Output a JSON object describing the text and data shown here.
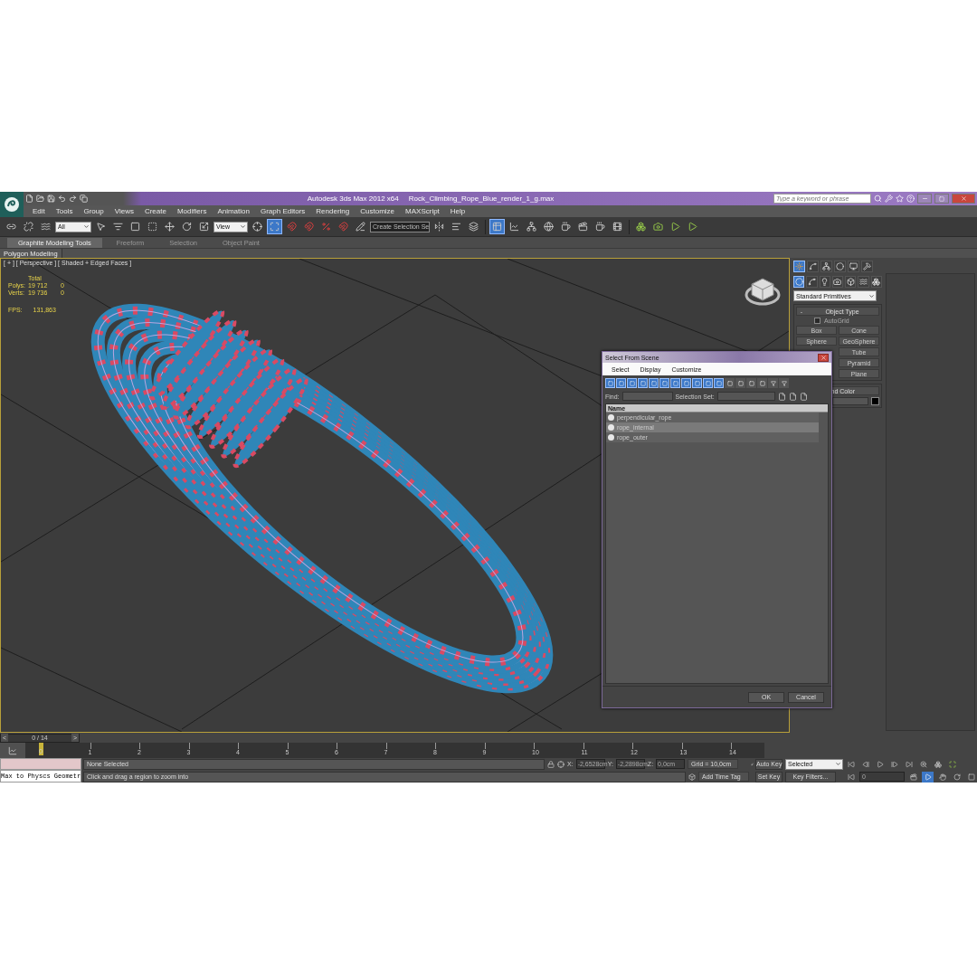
{
  "title_bar": {
    "app_title": "Autodesk 3ds Max  2012 x64",
    "file_name": "Rock_Climbing_Rope_Blue_render_1_g.max",
    "search": {
      "placeholder": "Type a keyword or phrase"
    }
  },
  "menu": [
    "Edit",
    "Tools",
    "Group",
    "Views",
    "Create",
    "Modifiers",
    "Animation",
    "Graph Editors",
    "Rendering",
    "Customize",
    "MAXScript",
    "Help"
  ],
  "main_toolbar": {
    "selection_filter": "All",
    "reference_coordinate": "View",
    "named_selection": "Create Selection Se"
  },
  "ribbon": {
    "tabs": [
      {
        "label": "Graphite Modeling Tools",
        "selected": true
      },
      {
        "label": "Freeform",
        "selected": false
      },
      {
        "label": "Selection",
        "selected": false
      },
      {
        "label": "Object Paint",
        "selected": false
      }
    ],
    "panel": "Polygon Modeling"
  },
  "viewport": {
    "label": "[ + ] [ Perspective ] [ Shaded + Edged Faces ]",
    "stats": {
      "total": "Total",
      "rows": [
        {
          "label": "Polys:",
          "total": "19 712",
          "selected": "0"
        },
        {
          "label": "Verts:",
          "total": "19 736",
          "selected": "0"
        }
      ],
      "fps_label": "FPS:",
      "fps": "131,863"
    }
  },
  "select_dialog": {
    "title": "Select From Scene",
    "menu": [
      "Select",
      "Display",
      "Customize"
    ],
    "display_filters": [
      {
        "on": true
      },
      {
        "on": true
      },
      {
        "on": true
      },
      {
        "on": true
      },
      {
        "on": true
      },
      {
        "on": true
      },
      {
        "on": true
      },
      {
        "on": true
      },
      {
        "on": true
      },
      {
        "on": true
      },
      {
        "on": true
      },
      {
        "on": false
      },
      {
        "on": false
      },
      {
        "on": false
      },
      {
        "on": false
      },
      {
        "on": false
      },
      {
        "on": false
      }
    ],
    "find_label": "Find:",
    "selection_set_label": "Selection Set:",
    "column": "Name",
    "rows": [
      {
        "name": "perpendicular_rope",
        "selected": false
      },
      {
        "name": "rope_internal",
        "selected": true
      },
      {
        "name": "rope_outer",
        "selected": false
      }
    ],
    "ok": "OK",
    "cancel": "Cancel"
  },
  "command_panel": {
    "tabs": [
      {
        "selected": true
      },
      {
        "selected": false
      },
      {
        "selected": false
      },
      {
        "selected": false
      },
      {
        "selected": false
      },
      {
        "selected": false
      }
    ],
    "categories": [
      {
        "selected": true
      },
      {
        "selected": false
      },
      {
        "selected": false
      },
      {
        "selected": false
      },
      {
        "selected": false
      },
      {
        "selected": false
      },
      {
        "selected": false
      }
    ],
    "primitive_type": "Standard Primitives",
    "object_type": {
      "title": "Object Type",
      "collapse": "-",
      "autogrid": {
        "label": "AutoGrid",
        "checked": false
      },
      "left_column": [
        "Box",
        "Sphere"
      ],
      "right_column": [
        "Cone",
        "GeoSphere",
        "Tube",
        "Pyramid",
        "Plane"
      ]
    },
    "name_color": {
      "title": "nd Color"
    }
  },
  "time_slider": {
    "level": 0,
    "frame": "0 / 14",
    "prev": "<",
    "next": ">"
  },
  "track_bar": {
    "ticks": [
      {
        "label": "0",
        "current": true
      },
      {
        "label": "1",
        "current": false
      },
      {
        "label": "2",
        "current": false
      },
      {
        "label": "3",
        "current": false
      },
      {
        "label": "4",
        "current": false
      },
      {
        "label": "5",
        "current": false
      },
      {
        "label": "6",
        "current": false
      },
      {
        "label": "7",
        "current": false
      },
      {
        "label": "8",
        "current": false
      },
      {
        "label": "9",
        "current": false
      },
      {
        "label": "10",
        "current": false
      },
      {
        "label": "11",
        "current": false
      },
      {
        "label": "12",
        "current": false
      },
      {
        "label": "13",
        "current": false
      },
      {
        "label": "14",
        "current": false
      }
    ]
  },
  "status": {
    "listener": "Max to Physcs Geometr",
    "selection": "None Selected",
    "prompt": "Click and drag a region to zoom into",
    "x_label": "X:",
    "x": "-2,6528cm",
    "y_label": "Y:",
    "y": "-2,2898cm",
    "z_label": "Z:",
    "z": "0,0cm",
    "grid": "Grid = 10,0cm",
    "time_tag": "Add Time Tag",
    "auto_key": "Auto Key",
    "key_mode": "Selected",
    "set_key": "Set Key",
    "key_filters": "Key Filters...",
    "frame": "0"
  }
}
